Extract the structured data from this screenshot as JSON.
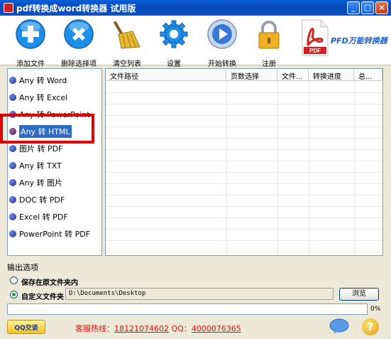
{
  "window": {
    "title": "pdf转换成word转换器 试用版",
    "buttons": {
      "minimize": "_",
      "maximize": "□",
      "close": "×"
    }
  },
  "toolbar": {
    "items": [
      {
        "label": "添加文件",
        "icon": "add-icon",
        "color": "#1e8fe8"
      },
      {
        "label": "删除选择项",
        "icon": "delete-icon",
        "color": "#1e8fe8"
      },
      {
        "label": "清空列表",
        "icon": "broom-icon",
        "color": "#e0a020"
      },
      {
        "label": "设置",
        "icon": "gear-icon",
        "color": "#1e8fe8"
      },
      {
        "label": "开始转换",
        "icon": "play-icon",
        "color": "#3a78d8"
      },
      {
        "label": "注册",
        "icon": "lock-icon",
        "color": "#f0b020"
      }
    ],
    "brand": "PFD万能转换器",
    "logo_text": "PDF"
  },
  "sidebar": {
    "items": [
      {
        "label": "Any 转 Word",
        "selected": false
      },
      {
        "label": "Any 转 Excel",
        "selected": false
      },
      {
        "label": "Any 转 PowerPoint",
        "selected": false
      },
      {
        "label": "Any 转 HTML",
        "selected": true
      },
      {
        "label": "图片 转 PDF",
        "selected": false
      },
      {
        "label": "Any 转 TXT",
        "selected": false
      },
      {
        "label": "Any 转 图片",
        "selected": false
      },
      {
        "label": "DOC 转 PDF",
        "selected": false
      },
      {
        "label": "Excel 转 PDF",
        "selected": false
      },
      {
        "label": "PowerPoint 转 PDF",
        "selected": false
      }
    ]
  },
  "table": {
    "columns": [
      "文件路径",
      "页数选择",
      "文件...",
      "转换进度",
      "总..."
    ]
  },
  "output": {
    "section_label": "输出选项",
    "option_same_folder": "保存在原文件夹内",
    "option_custom_folder": "自定义文件夹",
    "path_value": "D:\\Documents\\Desktop",
    "browse_label": "浏览"
  },
  "progress": {
    "percent_text": "0%",
    "value": 0
  },
  "footer": {
    "qq_label": "QQ交谈",
    "hotline_label": "客服热线：",
    "hotline_phone": "18121074602",
    "qq_prefix": " QQ：",
    "qq_number": "4000076365",
    "help_label": "?"
  }
}
